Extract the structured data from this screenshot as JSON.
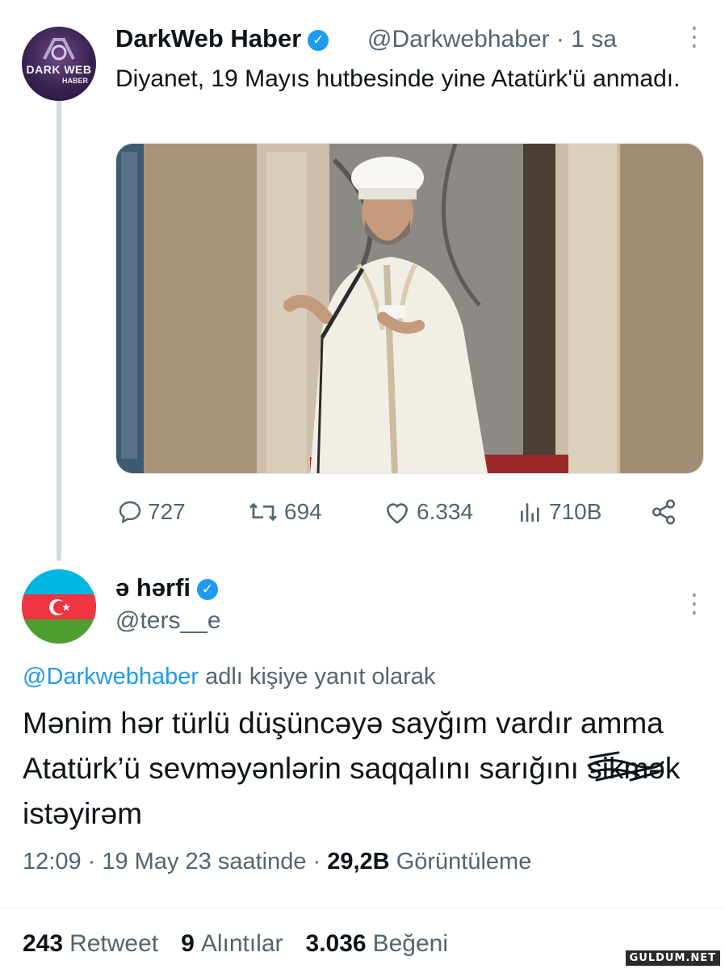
{
  "tweet1": {
    "avatar_text": "DARK WEB",
    "avatar_subtext": "HABER",
    "display_name": "DarkWeb Haber",
    "handle_time": "@Darkwebhaber · 1 sa",
    "text": "Diyanet, 19 Mayıs hutbesinde yine Atatürk'ü anmadı.",
    "actions": {
      "replies": "727",
      "retweets": "694",
      "likes": "6.334",
      "views": "710B"
    }
  },
  "tweet2": {
    "display_name": "ə hərfi",
    "handle": "@ters__e",
    "replying_mention": "@Darkwebhaber",
    "replying_suffix": "adlı kişiye yanıt olarak",
    "text_before": "Mənim hər türlü düşüncəyə sayğım vardır amma Atatürk’ü sevməyənlərin saqqalını sarığını",
    "text_struck": "sikmək",
    "text_after": "istəyirəm",
    "meta_time": "12:09 · 19 May 23 saatinde ·",
    "meta_views_count": "29,2B",
    "meta_views_label": "Görüntüleme",
    "stats": {
      "retweets_count": "243",
      "retweets_label": "Retweet",
      "quotes_count": "9",
      "quotes_label": "Alıntılar",
      "likes_count": "3.036",
      "likes_label": "Beğeni"
    }
  },
  "watermark": "GULDUM.NET",
  "colors": {
    "accent": "#1d9bf0",
    "secondary_text": "#536471",
    "primary_text": "#0f1419"
  },
  "icons": [
    "verified-badge-icon",
    "more-dots-icon",
    "reply-icon",
    "retweet-icon",
    "like-icon",
    "views-icon",
    "share-icon"
  ]
}
